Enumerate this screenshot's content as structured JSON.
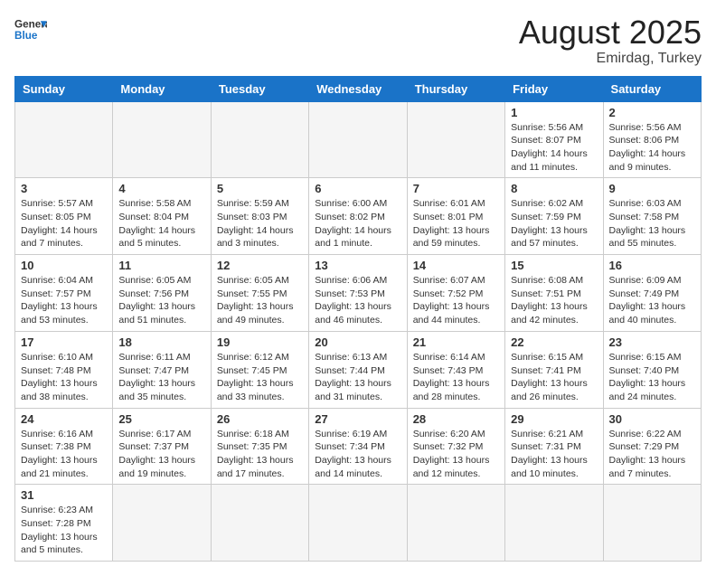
{
  "header": {
    "logo_general": "General",
    "logo_blue": "Blue",
    "title": "August 2025",
    "subtitle": "Emirdag, Turkey"
  },
  "days_of_week": [
    "Sunday",
    "Monday",
    "Tuesday",
    "Wednesday",
    "Thursday",
    "Friday",
    "Saturday"
  ],
  "weeks": [
    [
      {
        "day": "",
        "info": ""
      },
      {
        "day": "",
        "info": ""
      },
      {
        "day": "",
        "info": ""
      },
      {
        "day": "",
        "info": ""
      },
      {
        "day": "",
        "info": ""
      },
      {
        "day": "1",
        "info": "Sunrise: 5:56 AM\nSunset: 8:07 PM\nDaylight: 14 hours\nand 11 minutes."
      },
      {
        "day": "2",
        "info": "Sunrise: 5:56 AM\nSunset: 8:06 PM\nDaylight: 14 hours\nand 9 minutes."
      }
    ],
    [
      {
        "day": "3",
        "info": "Sunrise: 5:57 AM\nSunset: 8:05 PM\nDaylight: 14 hours\nand 7 minutes."
      },
      {
        "day": "4",
        "info": "Sunrise: 5:58 AM\nSunset: 8:04 PM\nDaylight: 14 hours\nand 5 minutes."
      },
      {
        "day": "5",
        "info": "Sunrise: 5:59 AM\nSunset: 8:03 PM\nDaylight: 14 hours\nand 3 minutes."
      },
      {
        "day": "6",
        "info": "Sunrise: 6:00 AM\nSunset: 8:02 PM\nDaylight: 14 hours\nand 1 minute."
      },
      {
        "day": "7",
        "info": "Sunrise: 6:01 AM\nSunset: 8:01 PM\nDaylight: 13 hours\nand 59 minutes."
      },
      {
        "day": "8",
        "info": "Sunrise: 6:02 AM\nSunset: 7:59 PM\nDaylight: 13 hours\nand 57 minutes."
      },
      {
        "day": "9",
        "info": "Sunrise: 6:03 AM\nSunset: 7:58 PM\nDaylight: 13 hours\nand 55 minutes."
      }
    ],
    [
      {
        "day": "10",
        "info": "Sunrise: 6:04 AM\nSunset: 7:57 PM\nDaylight: 13 hours\nand 53 minutes."
      },
      {
        "day": "11",
        "info": "Sunrise: 6:05 AM\nSunset: 7:56 PM\nDaylight: 13 hours\nand 51 minutes."
      },
      {
        "day": "12",
        "info": "Sunrise: 6:05 AM\nSunset: 7:55 PM\nDaylight: 13 hours\nand 49 minutes."
      },
      {
        "day": "13",
        "info": "Sunrise: 6:06 AM\nSunset: 7:53 PM\nDaylight: 13 hours\nand 46 minutes."
      },
      {
        "day": "14",
        "info": "Sunrise: 6:07 AM\nSunset: 7:52 PM\nDaylight: 13 hours\nand 44 minutes."
      },
      {
        "day": "15",
        "info": "Sunrise: 6:08 AM\nSunset: 7:51 PM\nDaylight: 13 hours\nand 42 minutes."
      },
      {
        "day": "16",
        "info": "Sunrise: 6:09 AM\nSunset: 7:49 PM\nDaylight: 13 hours\nand 40 minutes."
      }
    ],
    [
      {
        "day": "17",
        "info": "Sunrise: 6:10 AM\nSunset: 7:48 PM\nDaylight: 13 hours\nand 38 minutes."
      },
      {
        "day": "18",
        "info": "Sunrise: 6:11 AM\nSunset: 7:47 PM\nDaylight: 13 hours\nand 35 minutes."
      },
      {
        "day": "19",
        "info": "Sunrise: 6:12 AM\nSunset: 7:45 PM\nDaylight: 13 hours\nand 33 minutes."
      },
      {
        "day": "20",
        "info": "Sunrise: 6:13 AM\nSunset: 7:44 PM\nDaylight: 13 hours\nand 31 minutes."
      },
      {
        "day": "21",
        "info": "Sunrise: 6:14 AM\nSunset: 7:43 PM\nDaylight: 13 hours\nand 28 minutes."
      },
      {
        "day": "22",
        "info": "Sunrise: 6:15 AM\nSunset: 7:41 PM\nDaylight: 13 hours\nand 26 minutes."
      },
      {
        "day": "23",
        "info": "Sunrise: 6:15 AM\nSunset: 7:40 PM\nDaylight: 13 hours\nand 24 minutes."
      }
    ],
    [
      {
        "day": "24",
        "info": "Sunrise: 6:16 AM\nSunset: 7:38 PM\nDaylight: 13 hours\nand 21 minutes."
      },
      {
        "day": "25",
        "info": "Sunrise: 6:17 AM\nSunset: 7:37 PM\nDaylight: 13 hours\nand 19 minutes."
      },
      {
        "day": "26",
        "info": "Sunrise: 6:18 AM\nSunset: 7:35 PM\nDaylight: 13 hours\nand 17 minutes."
      },
      {
        "day": "27",
        "info": "Sunrise: 6:19 AM\nSunset: 7:34 PM\nDaylight: 13 hours\nand 14 minutes."
      },
      {
        "day": "28",
        "info": "Sunrise: 6:20 AM\nSunset: 7:32 PM\nDaylight: 13 hours\nand 12 minutes."
      },
      {
        "day": "29",
        "info": "Sunrise: 6:21 AM\nSunset: 7:31 PM\nDaylight: 13 hours\nand 10 minutes."
      },
      {
        "day": "30",
        "info": "Sunrise: 6:22 AM\nSunset: 7:29 PM\nDaylight: 13 hours\nand 7 minutes."
      }
    ],
    [
      {
        "day": "31",
        "info": "Sunrise: 6:23 AM\nSunset: 7:28 PM\nDaylight: 13 hours\nand 5 minutes."
      },
      {
        "day": "",
        "info": ""
      },
      {
        "day": "",
        "info": ""
      },
      {
        "day": "",
        "info": ""
      },
      {
        "day": "",
        "info": ""
      },
      {
        "day": "",
        "info": ""
      },
      {
        "day": "",
        "info": ""
      }
    ]
  ]
}
